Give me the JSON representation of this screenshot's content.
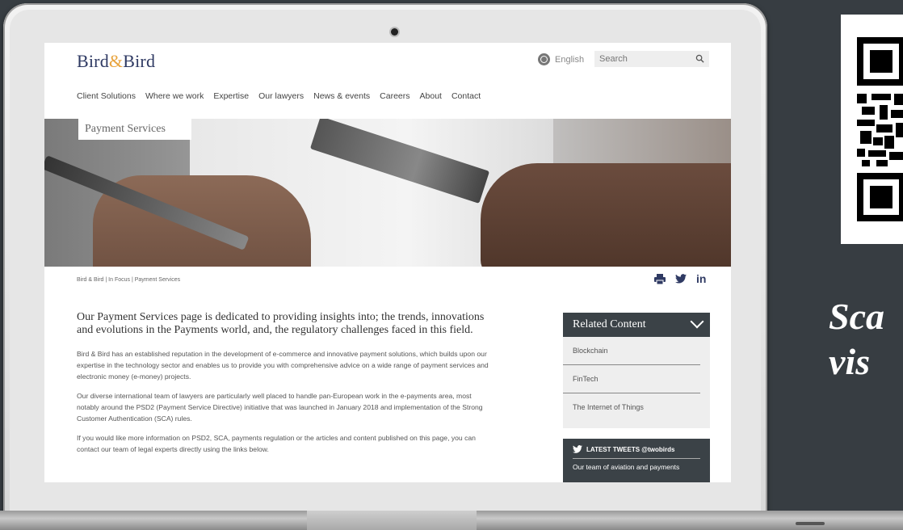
{
  "site": {
    "logo_part1": "Bird",
    "logo_amp": "&",
    "logo_part2": "Bird",
    "language": "English",
    "search_placeholder": "Search"
  },
  "nav": [
    "Client Solutions",
    "Where we work",
    "Expertise",
    "Our lawyers",
    "News & events",
    "Careers",
    "About",
    "Contact"
  ],
  "hero": {
    "label": "Payment Services"
  },
  "breadcrumb": "Bird & Bird  |  In Focus  |  Payment Services",
  "article": {
    "lede": "Our Payment Services page is dedicated to providing insights into; the trends, innovations and evolutions in the Payments world, and, the regulatory challenges faced in this field.",
    "paragraphs": [
      "Bird & Bird has an established reputation in the development of e-commerce and innovative payment solutions, which builds upon our expertise in the technology sector and enables us to provide you with comprehensive advice on a wide range of payment services and electronic money (e-money) projects.",
      "Our diverse international team of lawyers are particularly well placed to handle pan-European work in the e-payments area, most notably around the PSD2 (Payment Service Directive) initiative that was launched in January 2018 and implementation of the Strong Customer Authentication (SCA) rules.",
      "If you would like more information on PSD2, SCA, payments regulation or the articles and content published on this page, you can contact our team of legal experts directly using the links below."
    ]
  },
  "related": {
    "title": "Related Content",
    "items": [
      "Blockchain",
      "FinTech",
      "The Internet of Things"
    ]
  },
  "tweets": {
    "title": "LATEST TWEETS @twobirds",
    "text": "Our team of aviation and payments"
  },
  "side_text": {
    "line1": "Sca",
    "line2": "vis"
  },
  "colors": {
    "brand_navy": "#2f3a63",
    "brand_amber": "#e8a33d",
    "panel_dark": "#3b4247",
    "backdrop": "#373d42"
  }
}
